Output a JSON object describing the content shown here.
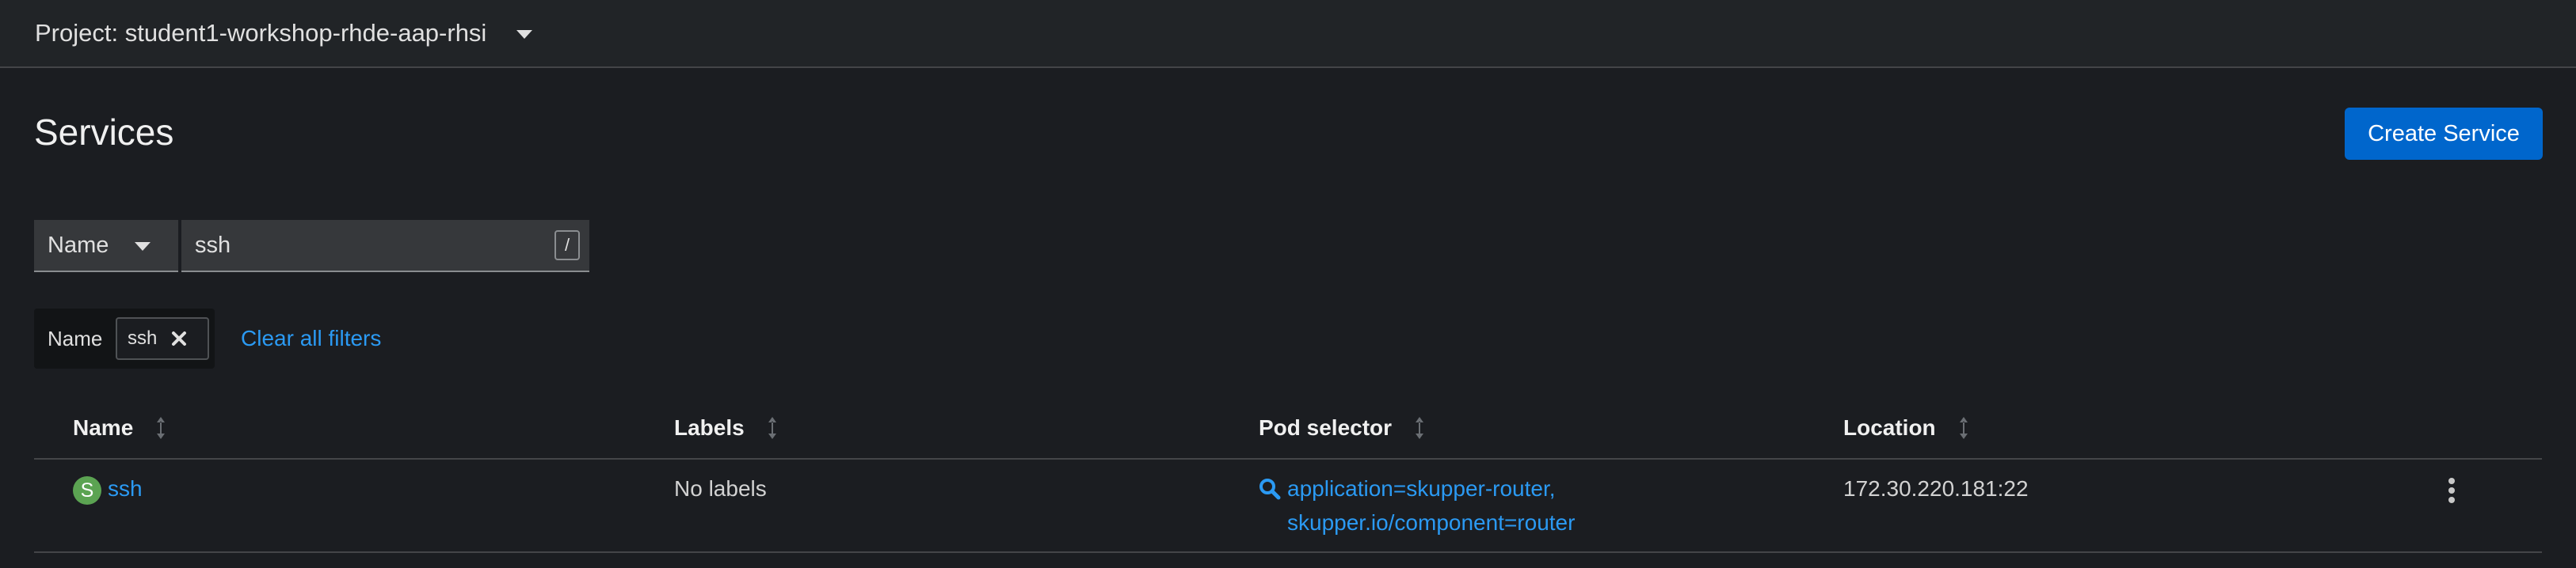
{
  "project_bar": {
    "label": "Project: student1-workshop-rhde-aap-rhsi"
  },
  "page": {
    "title": "Services",
    "create_button": "Create Service"
  },
  "filter": {
    "type": "Name",
    "value": "ssh",
    "shortcut": "/"
  },
  "active_filters": {
    "category": "Name",
    "chip": "ssh",
    "clear_all": "Clear all filters"
  },
  "table": {
    "columns": [
      "Name",
      "Labels",
      "Pod selector",
      "Location"
    ],
    "rows": [
      {
        "badge": "S",
        "name": "ssh",
        "labels": "No labels",
        "pod_selector_line1": "application=skupper-router,",
        "pod_selector_line2": "skupper.io/component=router",
        "location": "172.30.220.181:22"
      }
    ]
  },
  "colors": {
    "accent": "#0066cc",
    "link": "#2b9af3",
    "service_badge": "#5ba352"
  },
  "icons": [
    "caret-down-icon",
    "close-icon",
    "sort-icon",
    "search-icon",
    "kebab-icon"
  ]
}
